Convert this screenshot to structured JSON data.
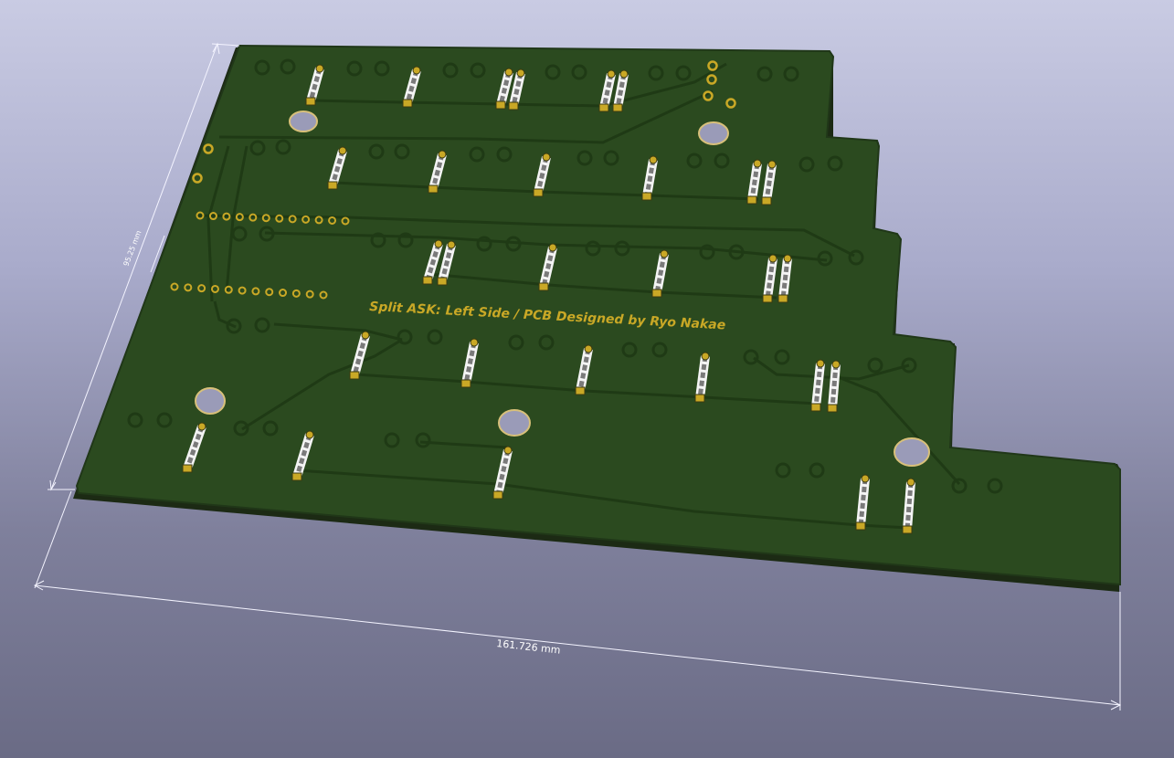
{
  "board": {
    "silkscreen_label": "Split ASK: Left Side / PCB Designed by Ryo Nakae",
    "width_dimension": "161.726 mm",
    "height_dimension": "95.25 mm"
  },
  "colors": {
    "soldermask": "#2b4a1f",
    "board_edge": "#1c2a14",
    "trace": "#1f3a15",
    "copper_pad": "#c9a826",
    "silkscreen": "#c9a826",
    "dimension_line": "#ffffff"
  }
}
